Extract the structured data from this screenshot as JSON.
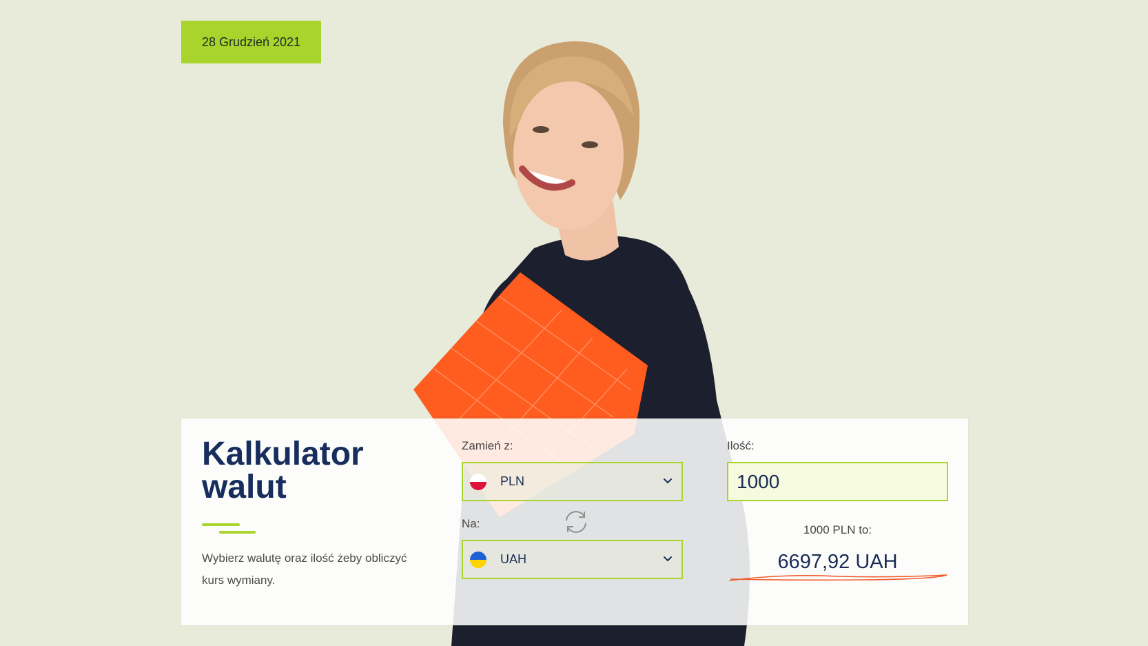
{
  "date_badge": "28 Grudzień 2021",
  "calculator": {
    "title": "Kalkulator walut",
    "description": "Wybierz walutę oraz ilość żeby obliczyć kurs wymiany.",
    "from": {
      "label": "Zamień z:",
      "currency": "PLN",
      "flag": "poland-flag"
    },
    "to": {
      "label": "Na:",
      "currency": "UAH",
      "flag": "ukraine-flag"
    },
    "amount": {
      "label": "Ilość:",
      "value": "1000"
    },
    "result": {
      "label": "1000 PLN to:",
      "value": "6697,92 UAH"
    },
    "icons": {
      "swap": "refresh-icon",
      "dropdown": "chevron-down-icon"
    }
  },
  "colors": {
    "background": "#e9ebda",
    "accent": "#a8d42c",
    "title": "#172d5e",
    "scribble": "#ef5a2a"
  }
}
